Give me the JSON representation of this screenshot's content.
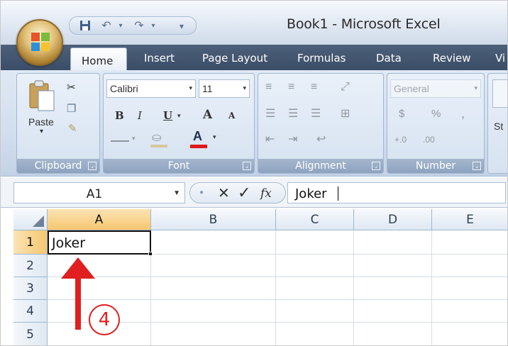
{
  "window": {
    "title": "Book1 - Microsoft Excel"
  },
  "tabs": [
    {
      "label": "Home"
    },
    {
      "label": "Insert"
    },
    {
      "label": "Page Layout"
    },
    {
      "label": "Formulas"
    },
    {
      "label": "Data"
    },
    {
      "label": "Review"
    },
    {
      "label": "Vi"
    }
  ],
  "ribbon": {
    "clipboard": {
      "label": "Clipboard",
      "paste_label": "Paste"
    },
    "font": {
      "label": "Font",
      "family": "Calibri",
      "size": "11",
      "bold": "B",
      "italic": "I",
      "underline": "U",
      "grow": "A",
      "shrink": "A",
      "font_color": "A"
    },
    "alignment": {
      "label": "Alignment"
    },
    "number": {
      "label": "Number",
      "format": "General",
      "currency": "$",
      "percent": "%",
      "comma": ",",
      "inc_decimal": "+.0",
      "dec_decimal": ".00"
    },
    "styles": {
      "label": "St"
    }
  },
  "formula_bar": {
    "name_box": "A1",
    "fx_label": "fx",
    "cancel_icon": "✕",
    "enter_icon": "✓",
    "content": "Joker"
  },
  "grid": {
    "columns": [
      "A",
      "B",
      "C",
      "D",
      "E"
    ],
    "rows": [
      "1",
      "2",
      "3",
      "4",
      "5"
    ],
    "active_cell": "A1",
    "active_cell_value": "Joker"
  },
  "annotation": {
    "step_number": "4"
  },
  "colors": {
    "annotation": "#e02020",
    "selected_header": "#f6c76f",
    "tab_bar": "#3b4d66"
  }
}
